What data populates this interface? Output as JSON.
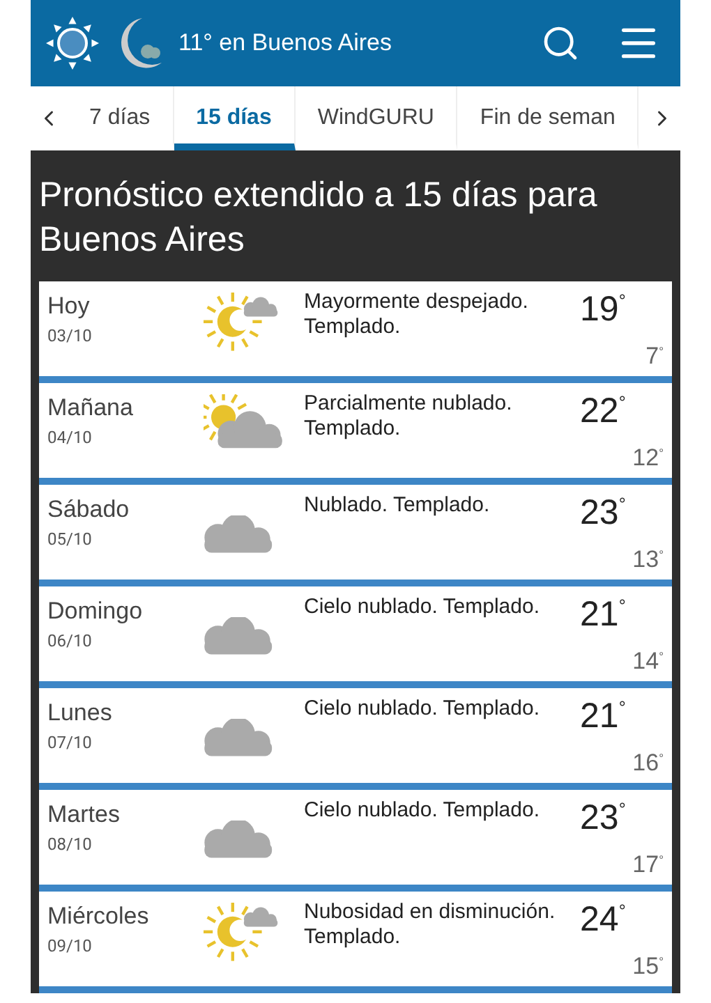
{
  "header": {
    "title": "11° en Buenos Aires"
  },
  "tabs": [
    {
      "label": "7 días",
      "selected": false
    },
    {
      "label": "15 días",
      "selected": true
    },
    {
      "label": "WindGURU",
      "selected": false
    },
    {
      "label": "Fin de seman",
      "selected": false
    }
  ],
  "heading": "Pronóstico extendido a 15 días para Buenos Aires",
  "days": [
    {
      "day": "Hoy",
      "date": "03/10",
      "kind": "clear",
      "description": "Mayormente despejado. Templado.",
      "high": "19$^{°}$",
      "low": "7$^{°}$"
    },
    {
      "day": "Mañana",
      "date": "04/10",
      "kind": "partly",
      "description": "Parcialmente nublado. Templado.",
      "high": "22$^{°}$",
      "low": "12$^{°}$"
    },
    {
      "day": "Sábado",
      "date": "05/10",
      "kind": "cloudy",
      "description": "Nublado. Templado.",
      "high": "23$^{°}$",
      "low": "13$^{°}$"
    },
    {
      "day": "Domingo",
      "date": "06/10",
      "kind": "cloudy",
      "description": "Cielo nublado. Templado.",
      "high": "21$^{°}$",
      "low": "14$^{°}$"
    },
    {
      "day": "Lunes",
      "date": "07/10",
      "kind": "cloudy",
      "description": "Cielo nublado. Templado.",
      "high": "21$^{°}$",
      "low": "16$^{°}$"
    },
    {
      "day": "Martes",
      "date": "08/10",
      "kind": "cloudy",
      "description": "Cielo nublado. Templado.",
      "high": "23$^{°}$",
      "low": "17$^{°}$"
    },
    {
      "day": "Miércoles",
      "date": "09/10",
      "kind": "clear",
      "description": "Nubosidad en disminución. Templado.",
      "high": "24$^{°}$",
      "low": "15$^{°}$"
    }
  ]
}
